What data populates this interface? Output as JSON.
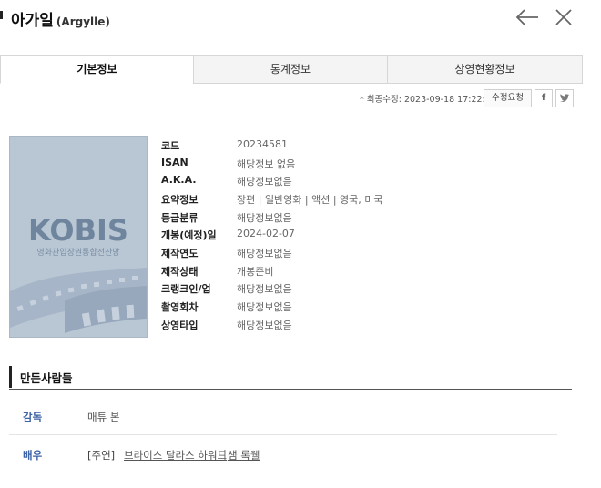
{
  "header": {
    "title_ko": "아가일",
    "title_en": "(Argylle)"
  },
  "tabs": [
    {
      "label": "기본정보",
      "active": true
    },
    {
      "label": "통계정보",
      "active": false
    },
    {
      "label": "상영현황정보",
      "active": false
    }
  ],
  "meta": {
    "updated": "* 최종수정: 2023-09-18 17:22:59",
    "edit_label": "수정요청",
    "facebook_label": "f",
    "twitter_label": "t"
  },
  "poster": {
    "logo": "KOBIS",
    "subtitle": "영화관입장권통합전산망"
  },
  "info": [
    {
      "label": "코드",
      "value": "20234581"
    },
    {
      "label": "ISAN",
      "value": "해당정보 없음"
    },
    {
      "label": "A.K.A.",
      "value": "해당정보없음"
    },
    {
      "label": "요약정보",
      "value": "장편 | 일반영화 | 액션 | 영국, 미국"
    },
    {
      "label": "등급분류",
      "value": "해당정보없음"
    },
    {
      "label": "개봉(예정)일",
      "value": "2024-02-07"
    },
    {
      "label": "제작연도",
      "value": "해당정보없음"
    },
    {
      "label": "제작상태",
      "value": "개봉준비"
    },
    {
      "label": "크랭크인/업",
      "value": "해당정보없음"
    },
    {
      "label": "촬영회차",
      "value": "해당정보없음"
    },
    {
      "label": "상영타입",
      "value": "해당정보없음"
    }
  ],
  "people": {
    "section_title": "만든사람들",
    "director_role": "감독",
    "director_name": "매튜 본",
    "actor_role": "배우",
    "actor_type": "[주연]",
    "actor_1": "브라이스 달라스 하워드",
    "actor_separator": "|",
    "actor_2": "샘 록웰"
  },
  "colors": {
    "role_text": "#3d63a6",
    "poster_bg": "#b9c6d4",
    "tab_inactive_bg": "#f4f4f4"
  }
}
